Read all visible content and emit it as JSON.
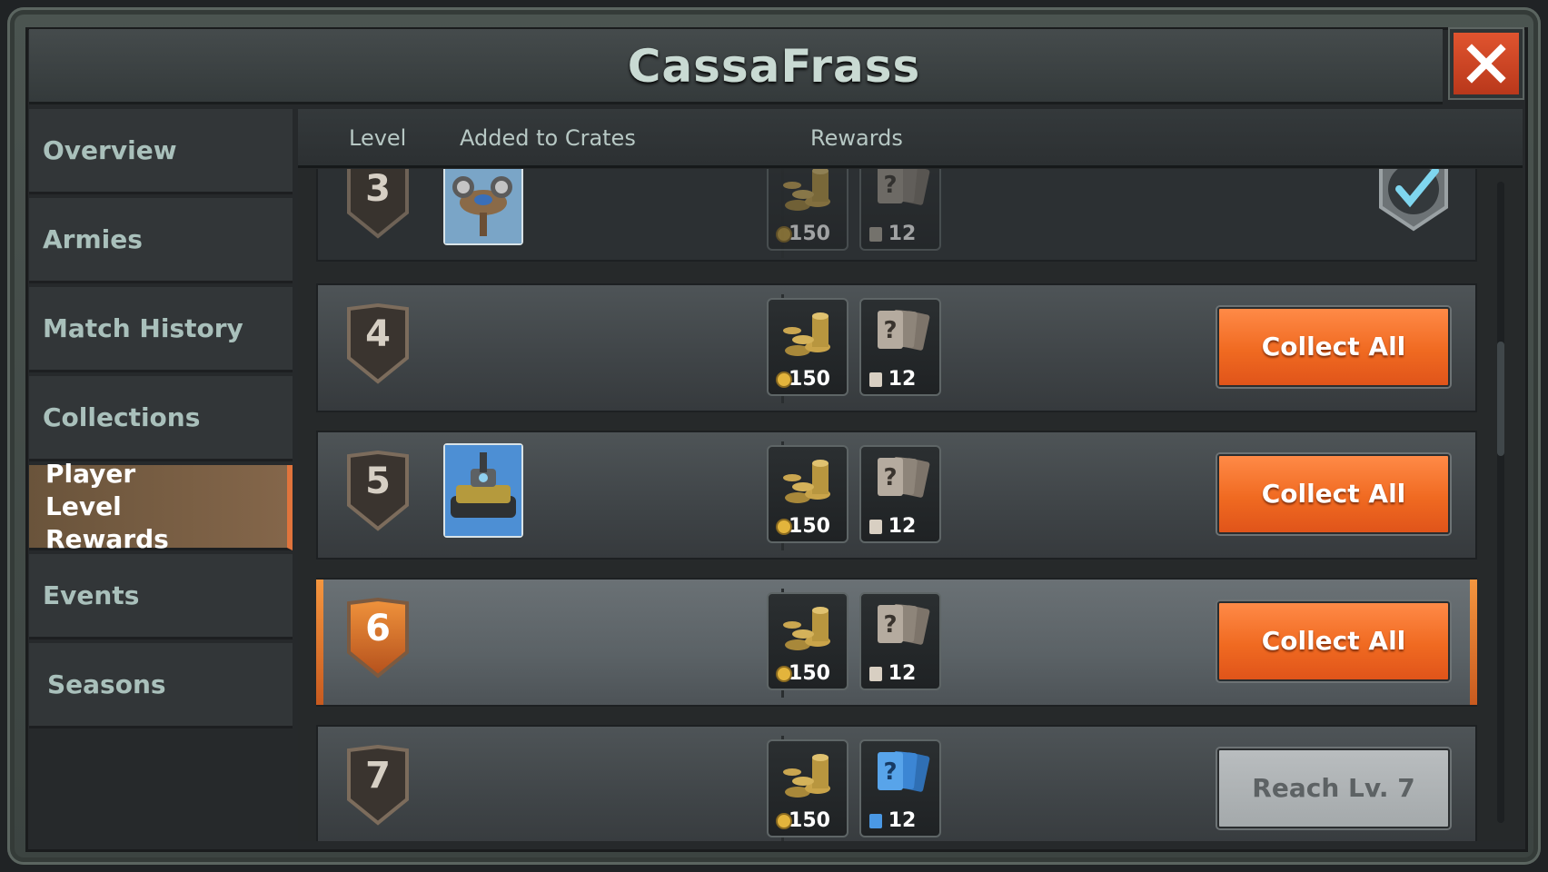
{
  "window": {
    "title": "CassaFrass"
  },
  "sidebar": {
    "items": [
      {
        "label": "Overview",
        "active": false
      },
      {
        "label": "Armies",
        "active": false
      },
      {
        "label": "Match History",
        "active": false
      },
      {
        "label": "Collections",
        "active": false
      },
      {
        "label": "Player Level Rewards",
        "active": true
      },
      {
        "label": "Events",
        "active": false
      },
      {
        "label": "Seasons",
        "active": false
      }
    ]
  },
  "table": {
    "headers": {
      "level": "Level",
      "added": "Added to Crates",
      "rewards": "Rewards"
    },
    "rows": [
      {
        "level": "3",
        "unit": "helicopter-unit-card",
        "gold": "150",
        "cards": "12",
        "state": "claimed"
      },
      {
        "level": "4",
        "unit": null,
        "gold": "150",
        "cards": "12",
        "state": "collect",
        "button": "Collect All"
      },
      {
        "level": "5",
        "unit": "tank-unit-card",
        "gold": "150",
        "cards": "12",
        "state": "collect",
        "button": "Collect All"
      },
      {
        "level": "6",
        "unit": null,
        "gold": "150",
        "cards": "12",
        "state": "collect",
        "button": "Collect All",
        "current": true
      },
      {
        "level": "7",
        "unit": null,
        "gold": "150",
        "cards": "12",
        "state": "locked",
        "button": "Reach Lv. 7"
      }
    ]
  },
  "colors": {
    "accent": "#f06a21",
    "active_nav": "#84664a",
    "close": "#d04a28"
  }
}
